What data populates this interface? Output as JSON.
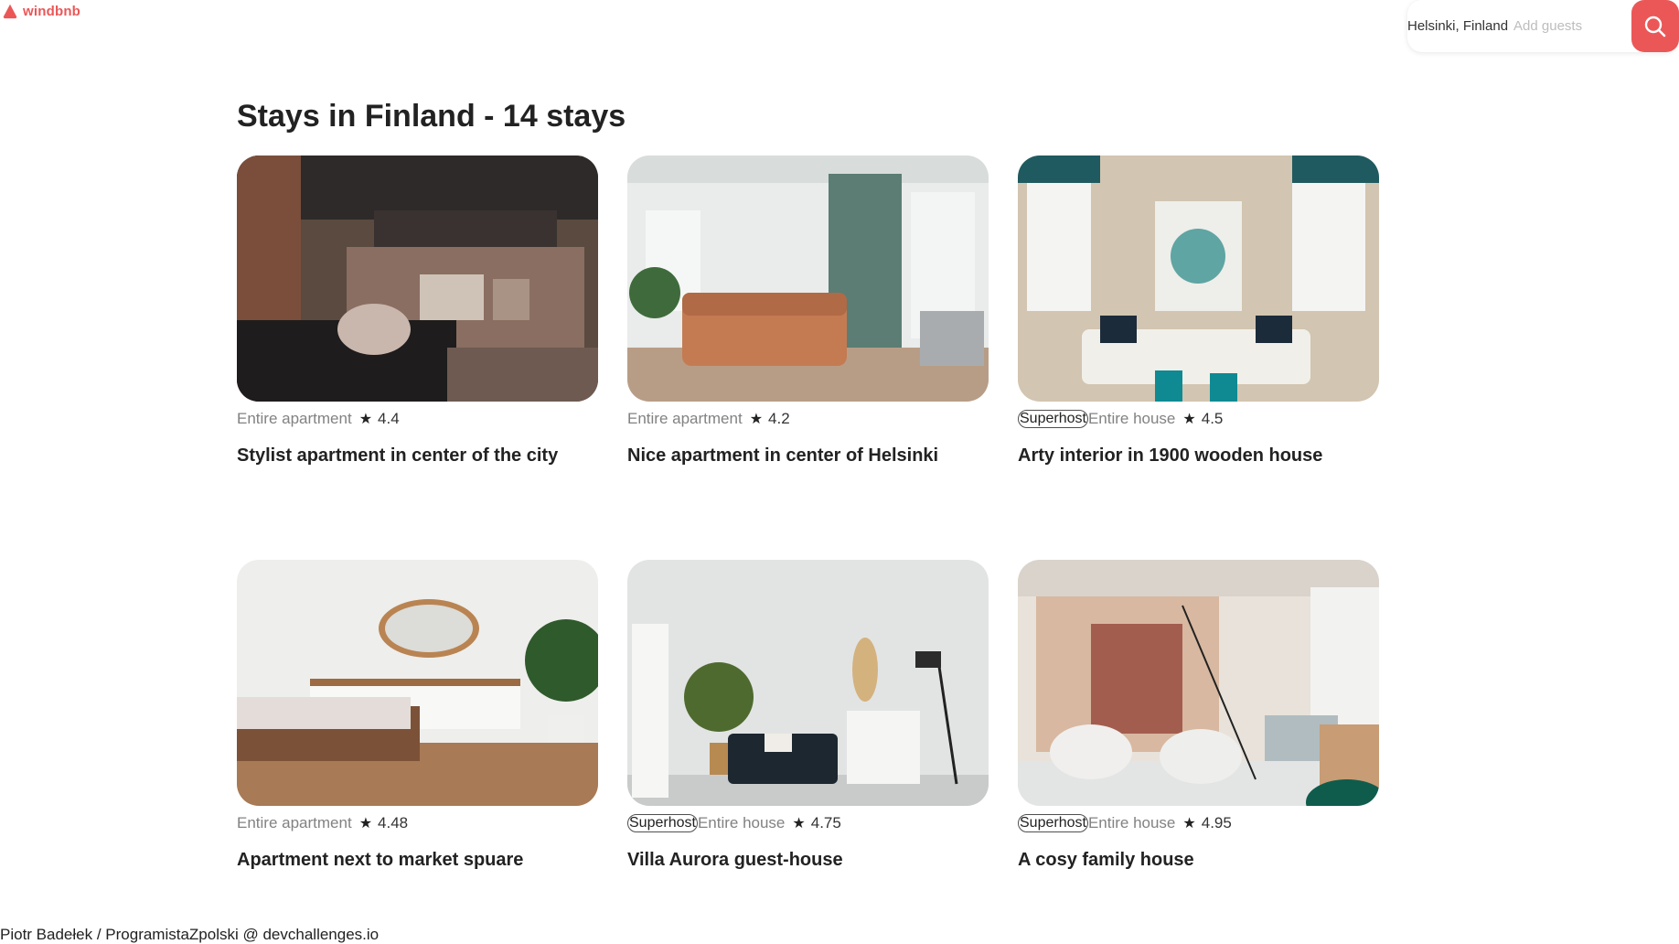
{
  "brand": {
    "name": "windbnb",
    "color": "#eb5757"
  },
  "search": {
    "location": "Helsinki, Finland",
    "guests_placeholder": "Add guests",
    "button_icon": "search-icon"
  },
  "page": {
    "title": "Stays in Finland - 14 stays"
  },
  "stays": [
    {
      "superhost": "",
      "type": "Entire apartment",
      "rating": "4.4",
      "title": "Stylist apartment in center of the city",
      "photo": "loft-living-room"
    },
    {
      "superhost": "",
      "type": "Entire apartment",
      "rating": "4.2",
      "title": "Nice apartment in center of Helsinki",
      "photo": "living-room-orange-sofa"
    },
    {
      "superhost": "Superhost",
      "type": "Entire house",
      "rating": "4.5",
      "title": "Arty interior in 1900 wooden house",
      "photo": "living-room-white-sofa"
    },
    {
      "superhost": "",
      "type": "Entire apartment",
      "rating": "4.48",
      "title": "Apartment next to market spuare",
      "photo": "bedroom-mirror"
    },
    {
      "superhost": "Superhost",
      "type": "Entire house",
      "rating": "4.75",
      "title": "Villa Aurora guest-house",
      "photo": "room-dark-sofa"
    },
    {
      "superhost": "Superhost",
      "type": "Entire house",
      "rating": "4.95",
      "title": "A cosy family house",
      "photo": "lounge-white-chairs"
    }
  ],
  "footer": {
    "credit": "Piotr Badełek / ProgramistaZpolski @ devchallenges.io"
  }
}
